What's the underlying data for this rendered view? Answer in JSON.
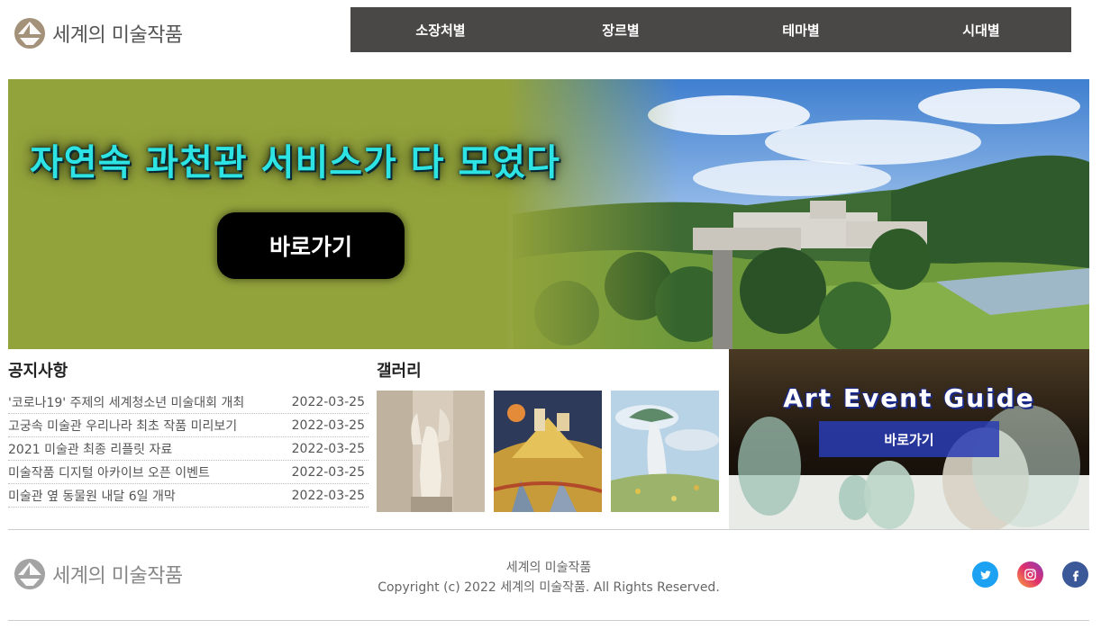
{
  "brand": {
    "name": "세계의 미술작품",
    "colors": {
      "logo": "#a3917a",
      "nav_bg": "#4a4847",
      "hero_green": "#93a33b",
      "hero_title": "#2de3e3"
    }
  },
  "nav": {
    "items": [
      {
        "label": "소장처별"
      },
      {
        "label": "장르별"
      },
      {
        "label": "테마별"
      },
      {
        "label": "시대별"
      }
    ]
  },
  "hero": {
    "title": "자연속 과천관 서비스가 다 모였다",
    "button_label": "바로가기"
  },
  "notice": {
    "title": "공지사항",
    "items": [
      {
        "title": "'코로나19' 주제의 세계청소년 미술대회 개최",
        "date": "2022-03-25"
      },
      {
        "title": "고궁속 미술관 우리나라 최초 작품 미리보기",
        "date": "2022-03-25"
      },
      {
        "title": "2021 미술관 최종 리플릿 자료",
        "date": "2022-03-25"
      },
      {
        "title": "미술작품 디지털 아카이브 오픈 이벤트",
        "date": "2022-03-25"
      },
      {
        "title": "미술관 옆 동물원 내달 6일 개막",
        "date": "2022-03-25"
      }
    ]
  },
  "gallery": {
    "title": "갤러리"
  },
  "event": {
    "title": "Art Event Guide",
    "button_label": "바로가기"
  },
  "footer": {
    "line1": "세계의 미술작품",
    "line2": "Copyright (c) 2022 세계의 미술작품. All Rights Reserved.",
    "social": [
      {
        "icon": "twitter-icon",
        "color": "#1da1f2"
      },
      {
        "icon": "instagram-icon",
        "color": "#e1306c"
      },
      {
        "icon": "facebook-icon",
        "color": "#3b5998"
      }
    ]
  }
}
